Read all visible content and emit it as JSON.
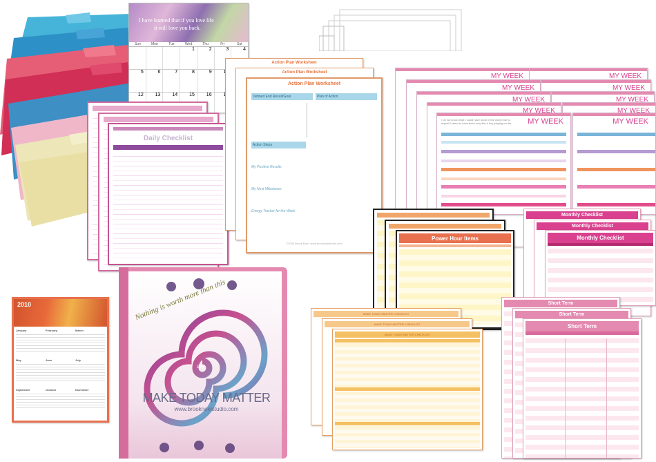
{
  "calendar": {
    "quote_line1": "I have learned that if you love life",
    "quote_line2": "it will love you back.",
    "weekdays": [
      "Sun",
      "Mon",
      "Tue",
      "Wed",
      "Thu",
      "Fri",
      "Sat"
    ],
    "row1": [
      "",
      "",
      "",
      "1",
      "2",
      "3",
      "4"
    ],
    "row2": [
      "5",
      "6",
      "7",
      "8",
      "9",
      "10",
      "11"
    ],
    "row3": [
      "12",
      "13",
      "14",
      "15",
      "16",
      "17",
      "18"
    ]
  },
  "daily_checklist": {
    "title": "Daily Checklist"
  },
  "action_plan": {
    "title": "Action Plan Worksheet",
    "section1": "Defined End Result/Goal",
    "section2": "Plan of Action",
    "section3": "Action Steps",
    "section4": "My Positive Results",
    "section5": "My Next Milestones",
    "section6": "Energy Tracker for the Week",
    "footer": "©2009 Brook Noel, www.brooknoelstudio.com"
  },
  "my_week": {
    "title": "MY WEEK",
    "quote": "I do not know what I could have done in the world; but to myself I seem to have been only like a boy playing on the seashore."
  },
  "power_hour": {
    "title": "Power Hour Items"
  },
  "monthly_checklist": {
    "title": "Monthly Checklist"
  },
  "short_term": {
    "title": "Short Term"
  },
  "mtm_checklist": {
    "title": "MAKE TODAY MATTER CHECKLIST"
  },
  "year_calendar": {
    "year": "2010",
    "months": [
      "January",
      "February",
      "March",
      "May",
      "June",
      "July",
      "September",
      "October",
      "November"
    ]
  },
  "binder": {
    "arc_text": "Nothing is worth more than this",
    "center_word": "day",
    "title": "MAKE TODAY MATTER",
    "url": "www.brooknoelstudio.com"
  },
  "colors": {
    "pink": "#d9418f",
    "purple": "#8e4b9d",
    "orange": "#e8733a",
    "yellow": "#f4c63e",
    "salmon": "#e8704e",
    "binder_pink": "#e48ab0"
  }
}
